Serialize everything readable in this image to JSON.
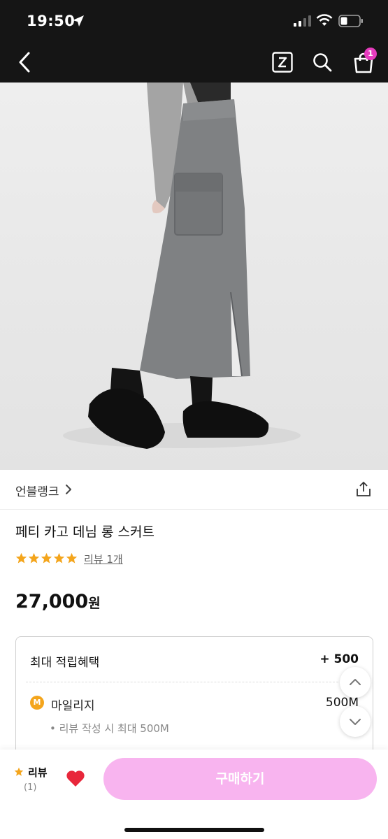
{
  "status": {
    "time": "19:50"
  },
  "header": {
    "cart_badge": "1"
  },
  "product": {
    "store_name": "언블랭크",
    "title": "페티 카고 데님 롱 스커트",
    "review_link": "리뷰 1개",
    "rating": 5,
    "price": "27,000",
    "currency": "원"
  },
  "benefits": {
    "heading": "최대 적립혜택",
    "total": "+ 500",
    "mileage_icon": "M",
    "mileage_label": "마일리지",
    "mileage_amount": "500M",
    "mileage_note": "• 리뷰 작성 시 최대 500M"
  },
  "bottom": {
    "review_label": "리뷰",
    "review_count": "(1)",
    "buy_label": "구매하기"
  },
  "colors": {
    "accent_pink": "#f8b4ef",
    "badge_magenta": "#e63cbe",
    "star_orange": "#f4a51c",
    "heart_red": "#e8273b"
  }
}
